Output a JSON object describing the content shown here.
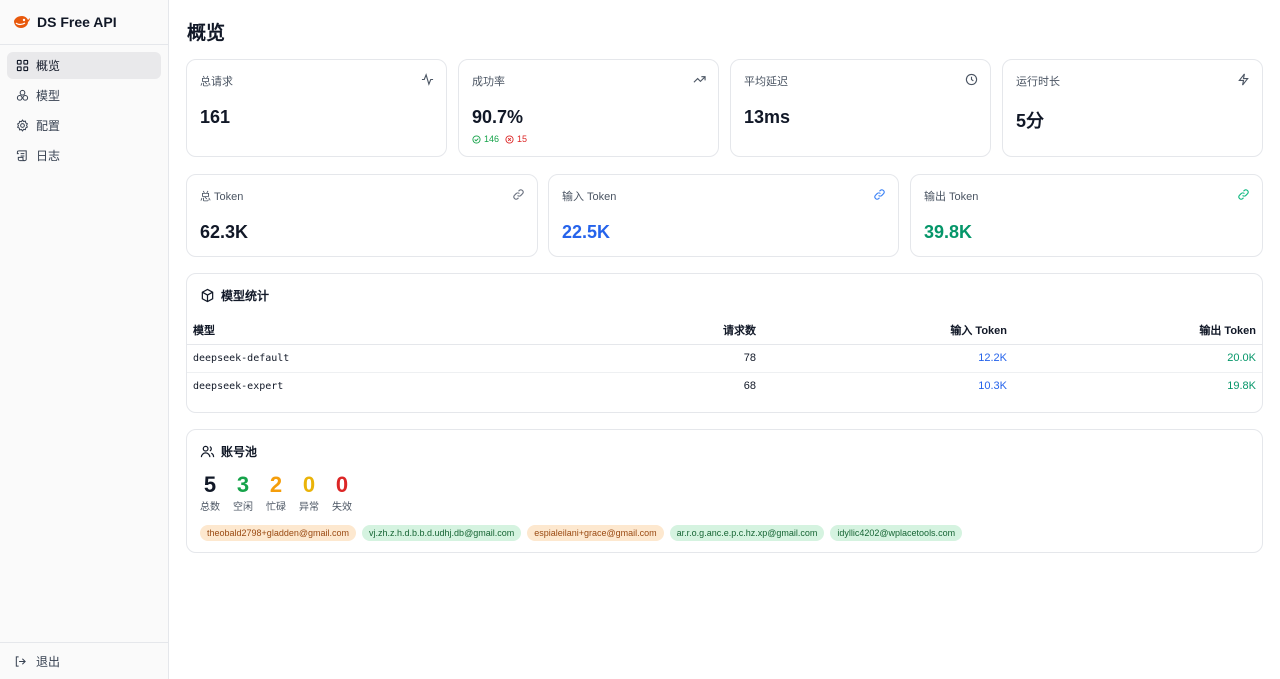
{
  "app": {
    "name": "DS Free API"
  },
  "sidebar": {
    "items": [
      {
        "label": "概览",
        "icon": "grid-icon",
        "active": true
      },
      {
        "label": "模型",
        "icon": "boxes-icon",
        "active": false
      },
      {
        "label": "配置",
        "icon": "gear-icon",
        "active": false
      },
      {
        "label": "日志",
        "icon": "scroll-icon",
        "active": false
      }
    ],
    "logout": "退出"
  },
  "page": {
    "title": "概览"
  },
  "stats": {
    "total_requests": {
      "label": "总请求",
      "value": "161",
      "icon": "activity-icon"
    },
    "success_rate": {
      "label": "成功率",
      "value": "90.7%",
      "ok": "146",
      "fail": "15",
      "icon": "trending-up-icon"
    },
    "avg_latency": {
      "label": "平均延迟",
      "value": "13ms",
      "icon": "clock-icon"
    },
    "uptime": {
      "label": "运行时长",
      "value": "5分",
      "icon": "bolt-icon"
    }
  },
  "tokens": {
    "total": {
      "label": "总 Token",
      "value": "62.3K",
      "color": "#111827"
    },
    "input": {
      "label": "输入 Token",
      "value": "22.5K",
      "color": "#2563eb"
    },
    "output": {
      "label": "输出 Token",
      "value": "39.8K",
      "color": "#059669"
    }
  },
  "model_stats": {
    "title": "模型统计",
    "columns": [
      "模型",
      "请求数",
      "输入 Token",
      "输出 Token"
    ],
    "rows": [
      {
        "model": "deepseek-default",
        "requests": "78",
        "input": "12.2K",
        "output": "20.0K"
      },
      {
        "model": "deepseek-expert",
        "requests": "68",
        "input": "10.3K",
        "output": "19.8K"
      }
    ]
  },
  "pool": {
    "title": "账号池",
    "stats": [
      {
        "value": "5",
        "label": "总数",
        "color": "#111827"
      },
      {
        "value": "3",
        "label": "空闲",
        "color": "#16a34a"
      },
      {
        "value": "2",
        "label": "忙碌",
        "color": "#f59e0b"
      },
      {
        "value": "0",
        "label": "异常",
        "color": "#eab308"
      },
      {
        "value": "0",
        "label": "失效",
        "color": "#dc2626"
      }
    ],
    "accounts": [
      {
        "email": "theobald2798+gladden@gmail.com",
        "status": "busy"
      },
      {
        "email": "vj.zh.z.h.d.b.b.d.udhj.db@gmail.com",
        "status": "idle"
      },
      {
        "email": "espialeilani+grace@gmail.com",
        "status": "busy"
      },
      {
        "email": "ar.r.o.g.anc.e.p.c.hz.xp@gmail.com",
        "status": "idle"
      },
      {
        "email": "idyllic4202@wplacetools.com",
        "status": "idle"
      }
    ]
  }
}
